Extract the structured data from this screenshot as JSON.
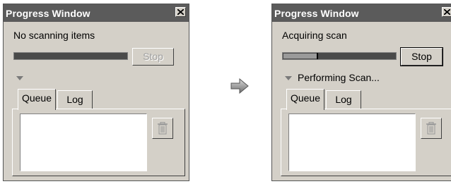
{
  "before": {
    "title": "Progress Window",
    "status_text": "No scanning items",
    "progress_fraction": 0,
    "stop_label": "Stop",
    "stop_enabled": false,
    "progress_text": "",
    "tabs": [
      {
        "label": "Queue",
        "selected": true
      },
      {
        "label": "Log",
        "selected": false
      }
    ]
  },
  "after": {
    "title": "Progress Window",
    "status_text": "Acquiring scan",
    "progress_fraction": 0.3,
    "stop_label": "Stop",
    "stop_enabled": true,
    "progress_text": "Performing Scan...",
    "tabs": [
      {
        "label": "Queue",
        "selected": true
      },
      {
        "label": "Log",
        "selected": false
      }
    ]
  },
  "icons": {
    "close": "close-icon",
    "delete": "trash-icon",
    "transition": "right-arrow-icon",
    "expander": "triangle-down-icon"
  }
}
